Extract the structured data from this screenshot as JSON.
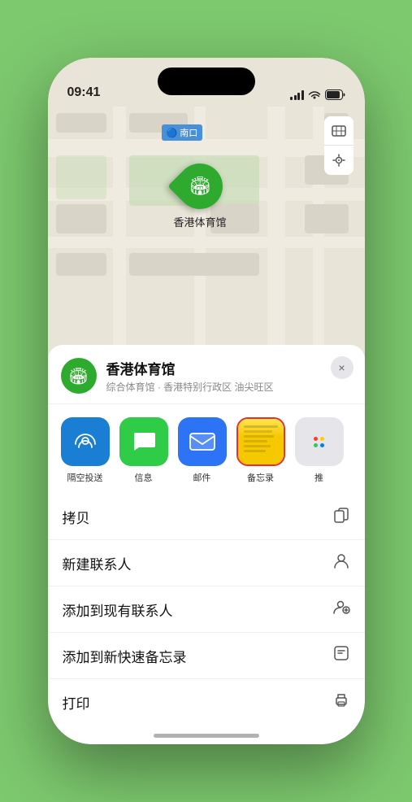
{
  "status": {
    "time": "09:41",
    "location_arrow": "▶"
  },
  "map": {
    "label": "南口",
    "stadium_name": "香港体育馆",
    "controls": {
      "map_icon": "🗺",
      "location_icon": "➤"
    }
  },
  "location_card": {
    "name": "香港体育馆",
    "subtitle": "综合体育馆 · 香港特别行政区 油尖旺区",
    "close": "×"
  },
  "share_items": [
    {
      "id": "airdrop",
      "label": "隔空投送",
      "emoji": "📡"
    },
    {
      "id": "message",
      "label": "信息",
      "emoji": "💬"
    },
    {
      "id": "mail",
      "label": "邮件",
      "emoji": "✉️"
    },
    {
      "id": "notes",
      "label": "备忘录",
      "emoji": ""
    },
    {
      "id": "more",
      "label": "推",
      "emoji": ""
    }
  ],
  "actions": [
    {
      "id": "copy",
      "label": "拷贝",
      "icon": "⎘"
    },
    {
      "id": "new-contact",
      "label": "新建联系人",
      "icon": "👤"
    },
    {
      "id": "add-contact",
      "label": "添加到现有联系人",
      "icon": "👤"
    },
    {
      "id": "add-notes",
      "label": "添加到新快速备忘录",
      "icon": "🗒"
    },
    {
      "id": "print",
      "label": "打印",
      "icon": "🖨"
    }
  ],
  "colors": {
    "green_accent": "#2eaa2e",
    "airdrop_bg": "#1a7fd4",
    "message_bg": "#2ecc47",
    "mail_bg": "#2d73f5",
    "notes_selected_border": "#e53030"
  }
}
